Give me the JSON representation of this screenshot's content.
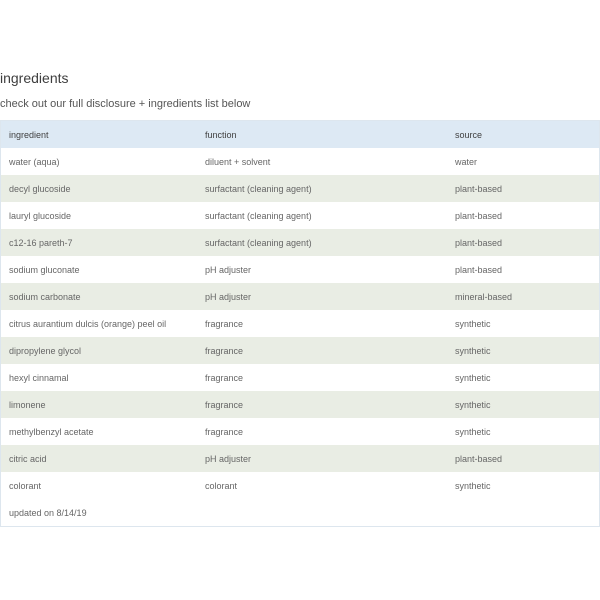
{
  "heading": "ingredients",
  "subheading": "check out our full disclosure + ingredients list below",
  "table": {
    "headers": [
      "ingredient",
      "function",
      "source"
    ],
    "rows": [
      [
        "water (aqua)",
        "diluent + solvent",
        "water"
      ],
      [
        "decyl glucoside",
        "surfactant (cleaning agent)",
        "plant-based"
      ],
      [
        "lauryl glucoside",
        "surfactant (cleaning agent)",
        "plant-based"
      ],
      [
        "c12-16 pareth-7",
        "surfactant (cleaning agent)",
        "plant-based"
      ],
      [
        "sodium gluconate",
        "pH adjuster",
        "plant-based"
      ],
      [
        "sodium carbonate",
        "pH adjuster",
        "mineral-based"
      ],
      [
        "citrus aurantium dulcis (orange) peel oil",
        "fragrance",
        "synthetic"
      ],
      [
        "dipropylene glycol",
        "fragrance",
        "synthetic"
      ],
      [
        "hexyl cinnamal",
        "fragrance",
        "synthetic"
      ],
      [
        "limonene",
        "fragrance",
        "synthetic"
      ],
      [
        "methylbenzyl acetate",
        "fragrance",
        "synthetic"
      ],
      [
        "citric acid",
        "pH adjuster",
        "plant-based"
      ],
      [
        "colorant",
        "colorant",
        "synthetic"
      ]
    ],
    "footer": "updated on 8/14/19"
  },
  "colors": {
    "header_bg": "#dde9f4",
    "stripe_bg": "#e9ede4",
    "text": "#666666"
  }
}
